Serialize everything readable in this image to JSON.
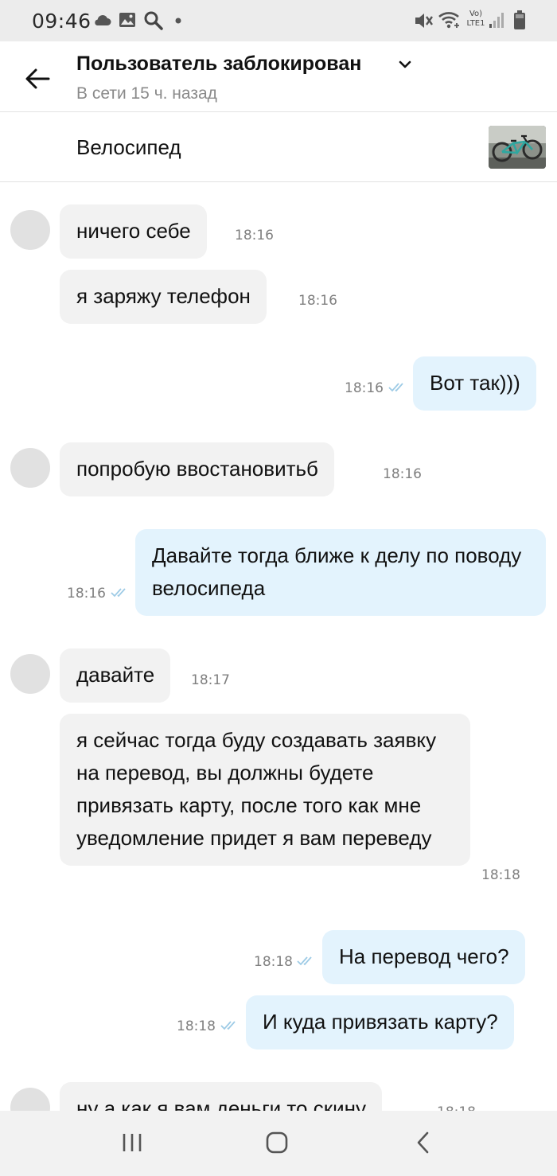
{
  "status_bar": {
    "time": "09:46",
    "left_icons": [
      "cloud-icon",
      "image-icon",
      "search-icon",
      "dot-icon"
    ],
    "right_icons": [
      "mute-icon",
      "wifi-icon",
      "volte-lte-icon",
      "signal-icon",
      "battery-icon"
    ],
    "volte_label": "Vo)",
    "lte_label": "LTE1"
  },
  "header": {
    "title": "Пользователь заблокирован",
    "subtitle": "В сети 15 ч. назад"
  },
  "item": {
    "title": "Велосипед",
    "thumbnail": "bicycle-photo"
  },
  "messages": [
    {
      "direction": "in",
      "text": "ничего себе",
      "time": "18:16"
    },
    {
      "direction": "in",
      "text": "я заряжу телефон",
      "time": "18:16"
    },
    {
      "direction": "out",
      "text": "Вот так)))",
      "time": "18:16",
      "status": "read"
    },
    {
      "direction": "in",
      "text": "попробую ввостановитьб",
      "time": "18:16"
    },
    {
      "direction": "out",
      "text": "Давайте тогда ближе к делу по поводу велосипеда",
      "time": "18:16",
      "status": "read"
    },
    {
      "direction": "in",
      "text": "давайте",
      "time": "18:17"
    },
    {
      "direction": "in",
      "text": "я сейчас тогда буду создавать заявку на перевод, вы должны будете привязать карту, после того как мне уведомление придет я вам переведу",
      "time": "18:18"
    },
    {
      "direction": "out",
      "text": "На перевод чего?",
      "time": "18:18",
      "status": "read"
    },
    {
      "direction": "out",
      "text": "И куда привязать карту?",
      "time": "18:18",
      "status": "read"
    },
    {
      "direction": "in",
      "text": "ну а как я вам деньги то скину",
      "time": "18:18"
    }
  ],
  "colors": {
    "incoming_bubble": "#f2f2f2",
    "outgoing_bubble": "#e3f3fd",
    "read_ticks": "#9ecbe6",
    "timestamp": "#7f7f7f",
    "avatar_placeholder": "#e1e1e1"
  },
  "nav_bar": {
    "buttons": [
      "recent-apps-icon",
      "home-icon",
      "back-icon"
    ]
  }
}
